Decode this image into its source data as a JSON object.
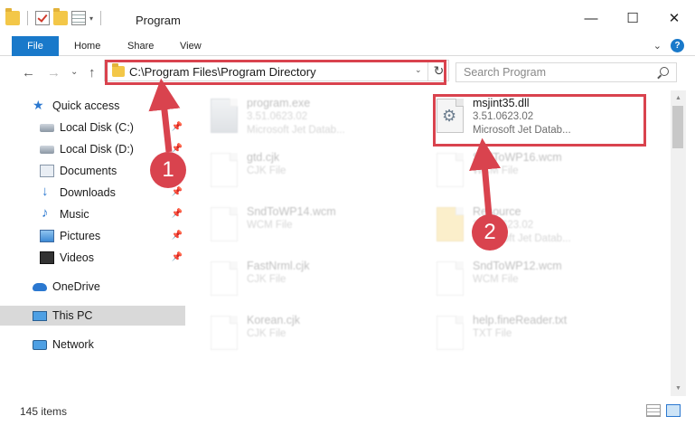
{
  "window": {
    "title": "Program",
    "minimize_glyph": "—",
    "maximize_glyph": "☐",
    "close_glyph": "✕"
  },
  "ribbon": {
    "tabs": [
      "File",
      "Home",
      "Share",
      "View"
    ],
    "help_label": "?"
  },
  "address": {
    "path": "C:\\Program Files\\Program Directory",
    "back_glyph": "←",
    "forward_glyph": "→",
    "recent_glyph": "⌄",
    "up_glyph": "↑",
    "dropdown_glyph": "⌄",
    "refresh_glyph": "↻"
  },
  "search": {
    "placeholder": "Search Program"
  },
  "sidebar": {
    "items": [
      {
        "label": "Quick access",
        "icon": "star-icon"
      },
      {
        "label": "Local Disk (C:)",
        "icon": "disk-icon",
        "pinned": true
      },
      {
        "label": "Local Disk (D:)",
        "icon": "disk-icon",
        "pinned": true
      },
      {
        "label": "Documents",
        "icon": "documents-icon",
        "pinned": true
      },
      {
        "label": "Downloads",
        "icon": "downloads-icon",
        "pinned": true
      },
      {
        "label": "Music",
        "icon": "music-icon",
        "pinned": true
      },
      {
        "label": "Pictures",
        "icon": "pictures-icon",
        "pinned": true
      },
      {
        "label": "Videos",
        "icon": "videos-icon",
        "pinned": true
      },
      {
        "label": "OneDrive",
        "icon": "onedrive-icon"
      },
      {
        "label": "This PC",
        "icon": "pc-icon",
        "selected": true
      },
      {
        "label": "Network",
        "icon": "network-icon"
      }
    ]
  },
  "files": [
    {
      "name": "program.exe",
      "line1": "3.51.0623.02",
      "line2": "Microsoft Jet Datab...",
      "icon": "exe-icon"
    },
    {
      "name": "msjint35.dll",
      "line1": "3.51.0623.02",
      "line2": "Microsoft Jet Datab...",
      "icon": "dll-icon"
    },
    {
      "name": "gtd.cjk",
      "line1": "CJK File",
      "line2": "",
      "icon": "file-icon"
    },
    {
      "name": "SndToWP16.wcm",
      "line1": "WCM File",
      "line2": "",
      "icon": "file-icon"
    },
    {
      "name": "SndToWP14.wcm",
      "line1": "WCM File",
      "line2": "",
      "icon": "file-icon"
    },
    {
      "name": "Resource",
      "line1": "3.51.0623.02",
      "line2": "Microsoft Jet Datab...",
      "icon": "folder-icon"
    },
    {
      "name": "FastNrml.cjk",
      "line1": "CJK File",
      "line2": "",
      "icon": "file-icon"
    },
    {
      "name": "SndToWP12.wcm",
      "line1": "WCM File",
      "line2": "",
      "icon": "file-icon"
    },
    {
      "name": "Korean.cjk",
      "line1": "CJK File",
      "line2": "",
      "icon": "file-icon"
    },
    {
      "name": "help.fineReader.txt",
      "line1": "TXT File",
      "line2": "",
      "icon": "file-icon"
    }
  ],
  "status": {
    "item_count": "145 items"
  },
  "annotations": {
    "badge1": "1",
    "badge2": "2",
    "color": "#d9434e"
  }
}
